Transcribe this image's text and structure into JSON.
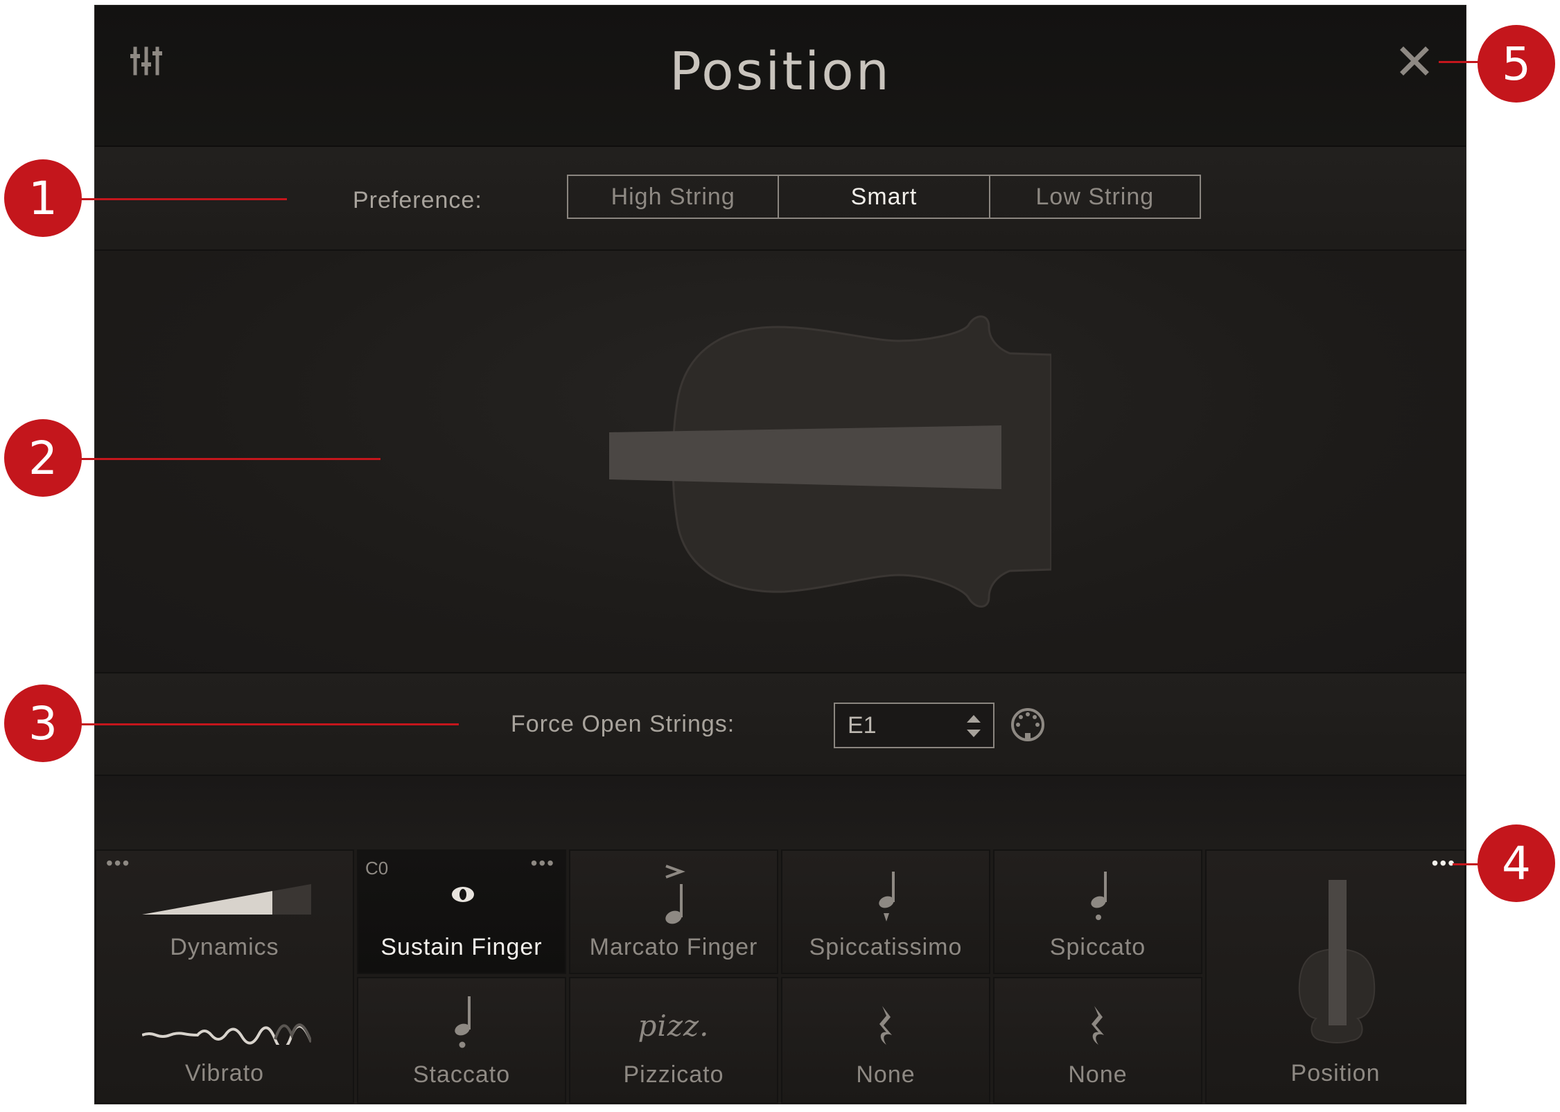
{
  "header": {
    "title": "Position"
  },
  "preference": {
    "label": "Preference:",
    "options": [
      "High String",
      "Smart",
      "Low String"
    ],
    "selected": "Smart"
  },
  "force_open_strings": {
    "label": "Force Open Strings:",
    "value": "E1"
  },
  "articulations": {
    "dynamics": {
      "label": "Dynamics"
    },
    "vibrato": {
      "label": "Vibrato"
    },
    "cells": [
      {
        "label": "Sustain Finger",
        "key": "C0",
        "selected": true
      },
      {
        "label": "Marcato Finger"
      },
      {
        "label": "Spiccatissimo"
      },
      {
        "label": "Spiccato"
      },
      {
        "label": "Staccato"
      },
      {
        "label": "Pizzicato",
        "glyph": "pizz."
      },
      {
        "label": "None"
      },
      {
        "label": "None"
      }
    ],
    "position": {
      "label": "Position"
    }
  },
  "callouts": [
    "1",
    "2",
    "3",
    "4",
    "5"
  ],
  "colors": {
    "panel_bg": "#1d1b19",
    "header_bg": "#131211",
    "callout_red": "#c4161c",
    "text_dim": "#8e8983",
    "text_bright": "#f4f1ec"
  },
  "icons": {
    "mixer": "mixer-sliders-icon",
    "close": "close-icon",
    "midi": "midi-port-icon",
    "stepper": "up-down-stepper-icon"
  }
}
